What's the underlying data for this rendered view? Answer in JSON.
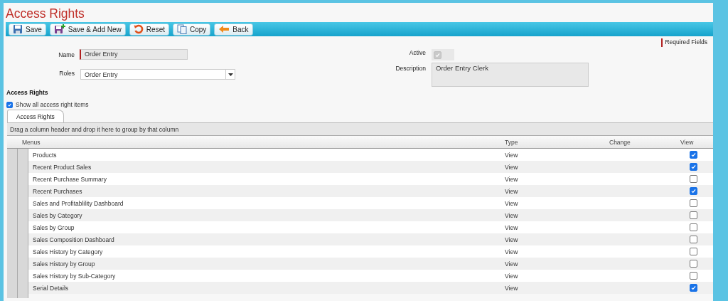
{
  "window": {
    "title": "Access Rights"
  },
  "toolbar": [
    {
      "label": "Save",
      "kind": "save"
    },
    {
      "label": "Save & Add New",
      "kind": "save_new"
    },
    {
      "label": "Reset",
      "kind": "reset"
    },
    {
      "label": "Copy",
      "kind": "copy"
    },
    {
      "label": "Back",
      "kind": "back"
    }
  ],
  "required_label": "Required Fields",
  "form": {
    "name": {
      "label": "Name",
      "value": "Order Entry"
    },
    "roles": {
      "label": "Roles",
      "value": "Order Entry"
    },
    "active": {
      "label": "Active",
      "checked": true
    },
    "description": {
      "label": "Description",
      "value": "Order Entry Clerk"
    }
  },
  "section_title": "Access Rights",
  "show_all": {
    "label": "Show all access right items",
    "checked": true
  },
  "tabs": [
    {
      "label": "Access Rights",
      "selected": true
    }
  ],
  "group_hint": "Drag a column header and drop it here to group by that column",
  "columns": [
    "Menus",
    "Type",
    "Change",
    "View"
  ],
  "rows": [
    {
      "menu": "Products",
      "type": "View",
      "view": true
    },
    {
      "menu": "Recent Product Sales",
      "type": "View",
      "view": true
    },
    {
      "menu": "Recent Purchase Summary",
      "type": "View",
      "view": false
    },
    {
      "menu": "Recent Purchases",
      "type": "View",
      "view": true
    },
    {
      "menu": "Sales and Profitablility Dashboard",
      "type": "View",
      "view": false
    },
    {
      "menu": "Sales by Category",
      "type": "View",
      "view": false
    },
    {
      "menu": "Sales by Group",
      "type": "View",
      "view": false
    },
    {
      "menu": "Sales Composition Dashboard",
      "type": "View",
      "view": false
    },
    {
      "menu": "Sales History by Category",
      "type": "View",
      "view": false
    },
    {
      "menu": "Sales History by Group",
      "type": "View",
      "view": false
    },
    {
      "menu": "Sales History by Sub-Category",
      "type": "View",
      "view": false
    },
    {
      "menu": "Serial Details",
      "type": "View",
      "view": true
    }
  ]
}
